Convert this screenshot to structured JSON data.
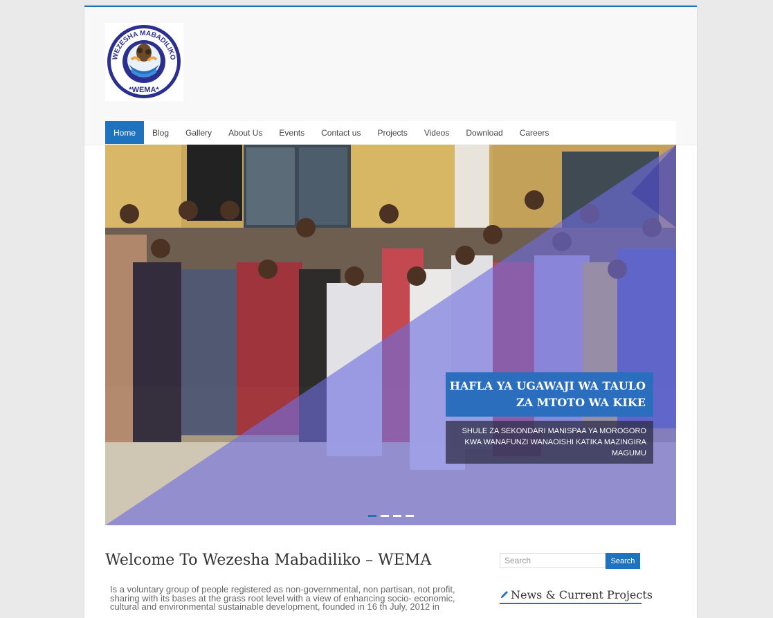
{
  "header": {
    "logo_text_top": "WEZESHA MABADILIKO",
    "logo_text_bottom": "*WEMA*"
  },
  "nav": {
    "items": [
      "Home",
      "Blog",
      "Gallery",
      "About Us",
      "Events",
      "Contact us",
      "Projects",
      "Videos",
      "Download",
      "Careers"
    ],
    "active": "Home"
  },
  "slider": {
    "title_line1": "HAFLA YA UGAWAJI WA TAULO",
    "title_line2": "ZA MTOTO WA KIKE",
    "subtitle_line1": "SHULE ZA SEKONDARI MANISPAA YA MOROGORO",
    "subtitle_line2": "KWA WANAFUNZI WANAOISHI KATIKA MAZINGIRA",
    "subtitle_line3": "MAGUMU",
    "slide_count": 4,
    "active_slide": 1
  },
  "content": {
    "welcome_title": "Welcome To Wezesha Mabadiliko – WEMA",
    "intro_text": "Is a voluntary group of people registered as non-governmental, non partisan, not profit, sharing with its bases at the grass root level with a view of enhancing socio- economic, cultural and environmental sustainable development, founded in 16 th July, 2012 in"
  },
  "sidebar": {
    "search_placeholder": "Search",
    "search_button": "Search",
    "widget_title": "News & Current Projects",
    "widget_icon": "pencil-icon"
  },
  "colors": {
    "accent": "#1e73be",
    "overlay": "#6e6ee0"
  }
}
